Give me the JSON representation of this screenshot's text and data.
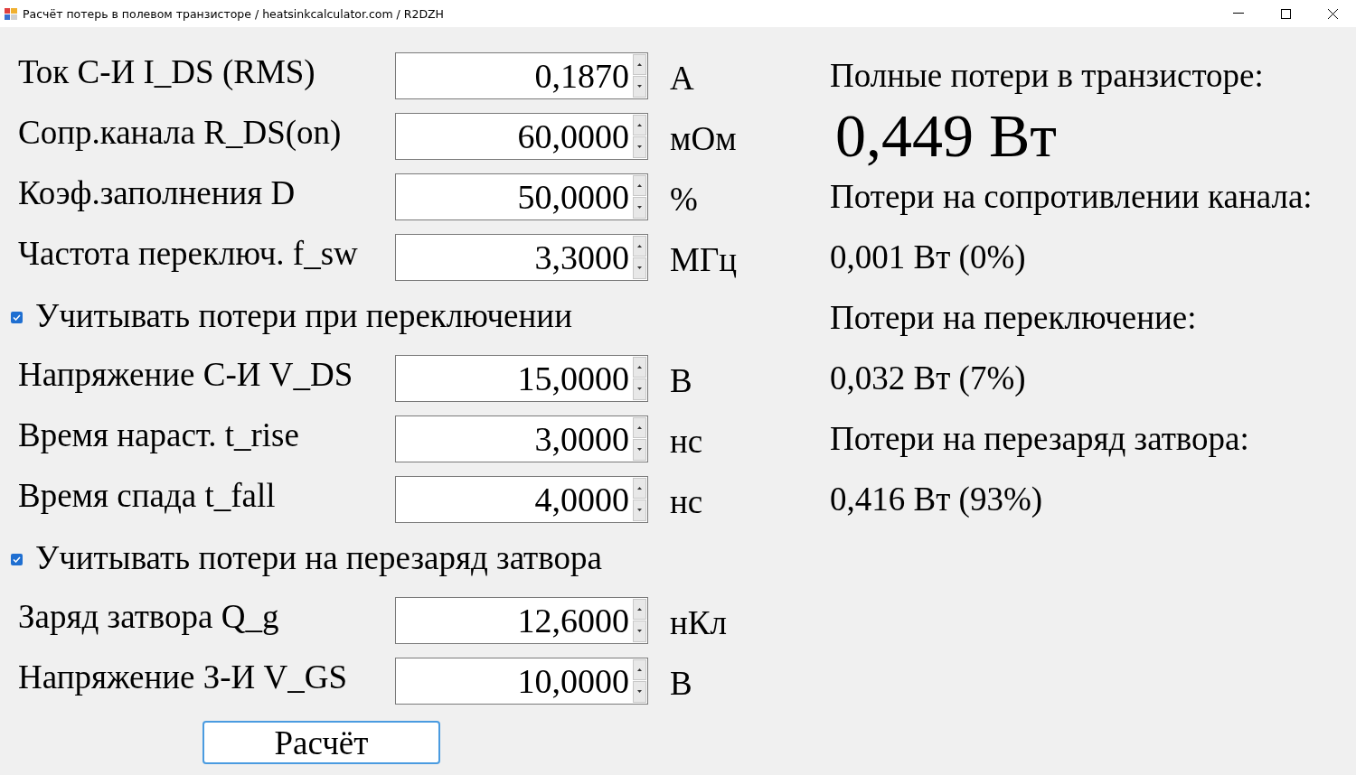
{
  "window": {
    "title": "Расчёт потерь в полевом транзисторе / heatsinkcalculator.com / R2DZH"
  },
  "inputs": [
    {
      "kind": "field",
      "label": "Ток С-И I_DS (RMS)",
      "value": "0,1870",
      "unit": "А"
    },
    {
      "kind": "field",
      "label": "Сопр.канала R_DS(on)",
      "value": "60,0000",
      "unit": "мОм"
    },
    {
      "kind": "field",
      "label": "Коэф.заполнения  D",
      "value": "50,0000",
      "unit": "%"
    },
    {
      "kind": "field",
      "label": "Частота переключ. f_sw",
      "value": "3,3000",
      "unit": "МГц"
    },
    {
      "kind": "checkbox",
      "label": "Учитывать потери при переключении",
      "checked": true
    },
    {
      "kind": "field",
      "label": "Напряжение С-И V_DS",
      "value": "15,0000",
      "unit": "В"
    },
    {
      "kind": "field",
      "label": "Время нараст. t_rise",
      "value": "3,0000",
      "unit": "нс"
    },
    {
      "kind": "field",
      "label": "Время спада t_fall",
      "value": "4,0000",
      "unit": "нс"
    },
    {
      "kind": "checkbox",
      "label": "Учитывать потери на перезаряд затвора",
      "checked": true
    },
    {
      "kind": "field",
      "label": "Заряд затвора Q_g",
      "value": "12,6000",
      "unit": "нКл"
    },
    {
      "kind": "field",
      "label": "Напряжение З-И V_GS",
      "value": "10,0000",
      "unit": "В"
    }
  ],
  "calculate_button": "Расчёт",
  "results": [
    {
      "kind": "heading",
      "text": "Полные потери в транзисторе:"
    },
    {
      "kind": "total",
      "text": "0,449 Вт"
    },
    {
      "kind": "heading",
      "text": "Потери на сопротивлении канала:"
    },
    {
      "kind": "value",
      "text": "0,001 Вт (0%)"
    },
    {
      "kind": "heading",
      "text": "Потери на переключение:"
    },
    {
      "kind": "value",
      "text": "0,032 Вт (7%)"
    },
    {
      "kind": "heading",
      "text": "Потери на перезаряд затвора:"
    },
    {
      "kind": "value",
      "text": "0,416 Вт (93%)"
    }
  ]
}
